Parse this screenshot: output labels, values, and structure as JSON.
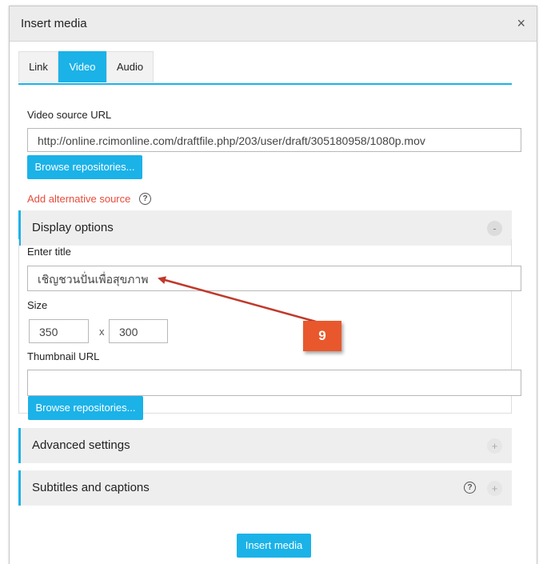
{
  "dialog": {
    "title": "Insert media",
    "close_glyph": "×"
  },
  "tabs": [
    {
      "label": "Link",
      "active": false
    },
    {
      "label": "Video",
      "active": true
    },
    {
      "label": "Audio",
      "active": false
    }
  ],
  "video": {
    "source_label": "Video source URL",
    "source_value": "http://online.rcimonline.com/draftfile.php/203/user/draft/305180958/1080p.mov",
    "browse_label": "Browse repositories...",
    "add_alt_label": "Add alternative source",
    "help_glyph": "?"
  },
  "display_options": {
    "title": "Display options",
    "toggle_glyph": "-",
    "enter_title_label": "Enter title",
    "title_value": "เชิญชวนปั่นเพื่อสุขภาพ",
    "size_label": "Size",
    "width_value": "350",
    "x_sep": "x",
    "height_value": "300",
    "thumbnail_label": "Thumbnail URL",
    "thumbnail_value": "",
    "browse_label": "Browse repositories..."
  },
  "advanced": {
    "title": "Advanced settings",
    "toggle_glyph": "+"
  },
  "subtitles": {
    "title": "Subtitles and captions",
    "help_glyph": "?",
    "toggle_glyph": "+"
  },
  "footer": {
    "insert_label": "Insert media"
  },
  "annotation": {
    "callout_number": "9"
  },
  "colors": {
    "accent": "#1bb2e8",
    "link_red": "#e74c3c",
    "callout": "#e8582c",
    "arrow": "#c0392b"
  },
  "icons": {
    "close": "close-icon",
    "help": "question-circle-icon",
    "collapse": "minus-circle-icon",
    "expand": "plus-circle-icon"
  }
}
